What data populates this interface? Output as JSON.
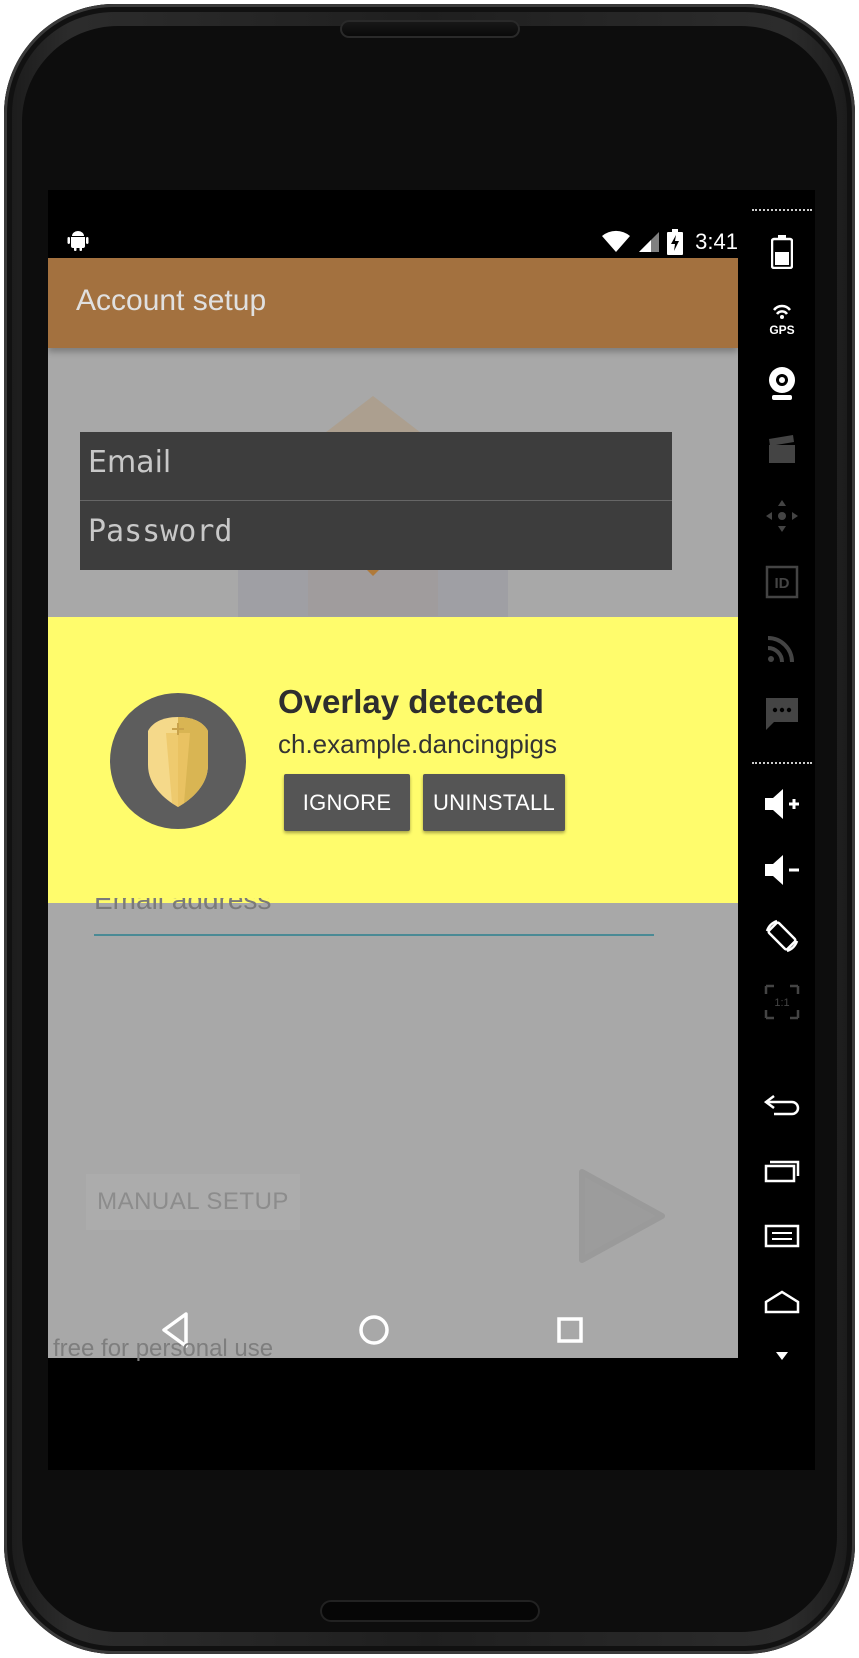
{
  "statusbar": {
    "time": "3:41"
  },
  "appbar": {
    "title": "Account setup"
  },
  "credential_overlay": {
    "email_placeholder": "Email",
    "password_placeholder": "Password"
  },
  "overlay_warning": {
    "title": "Overlay detected",
    "package": "ch.example.dancingpigs",
    "ignore_label": "IGNORE",
    "uninstall_label": "UNINSTALL"
  },
  "form": {
    "email_address_placeholder": "Email address",
    "manual_setup_label": "MANUAL SETUP"
  },
  "watermark": "free for personal use",
  "navbar": {
    "icons": [
      "back-icon",
      "home-icon",
      "recents-icon"
    ]
  },
  "emulator_sidebar": {
    "items": [
      "battery-icon",
      "gps-icon",
      "camera-icon",
      "video-icon",
      "dpad-icon",
      "id-icon",
      "rss-icon",
      "sms-icon",
      "volume-up-icon",
      "volume-down-icon",
      "rotate-icon",
      "scale-icon",
      "back-icon",
      "recents-icon",
      "menu-icon",
      "home-icon",
      "more-icon"
    ],
    "gps_label": "GPS",
    "id_label": "ID",
    "scale_label": "1:1"
  },
  "colors": {
    "appbar": "#a3713f",
    "overlay_banner": "#fffc6c",
    "button": "#555555",
    "field_underline": "#4a8a95"
  }
}
